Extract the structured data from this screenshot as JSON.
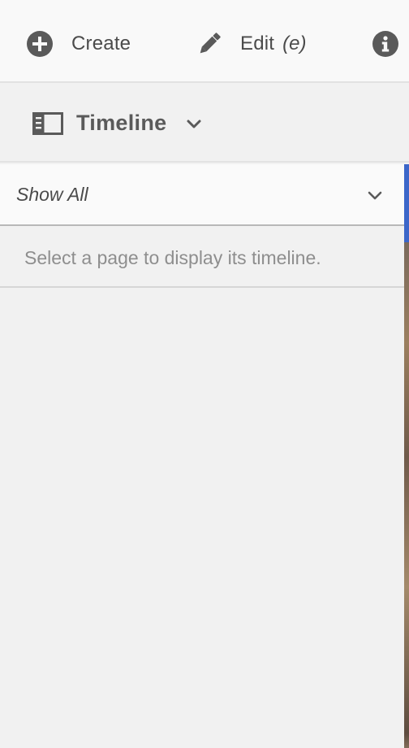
{
  "toolbar": {
    "create_label": "Create",
    "edit_label": "Edit",
    "edit_shortcut": "(e)",
    "icons": {
      "create": "add-circle-icon",
      "edit": "pencil-icon",
      "info": "info-icon"
    }
  },
  "rail": {
    "title": "Timeline",
    "icon": "rail-panel-icon"
  },
  "filter": {
    "selected": "Show All"
  },
  "timeline": {
    "empty_message": "Select a page to display its timeline."
  },
  "colors": {
    "accent": "#3b66c9",
    "icon": "#5a5a5a",
    "text": "#4b4b4b",
    "muted_text": "#8e8e8e"
  }
}
